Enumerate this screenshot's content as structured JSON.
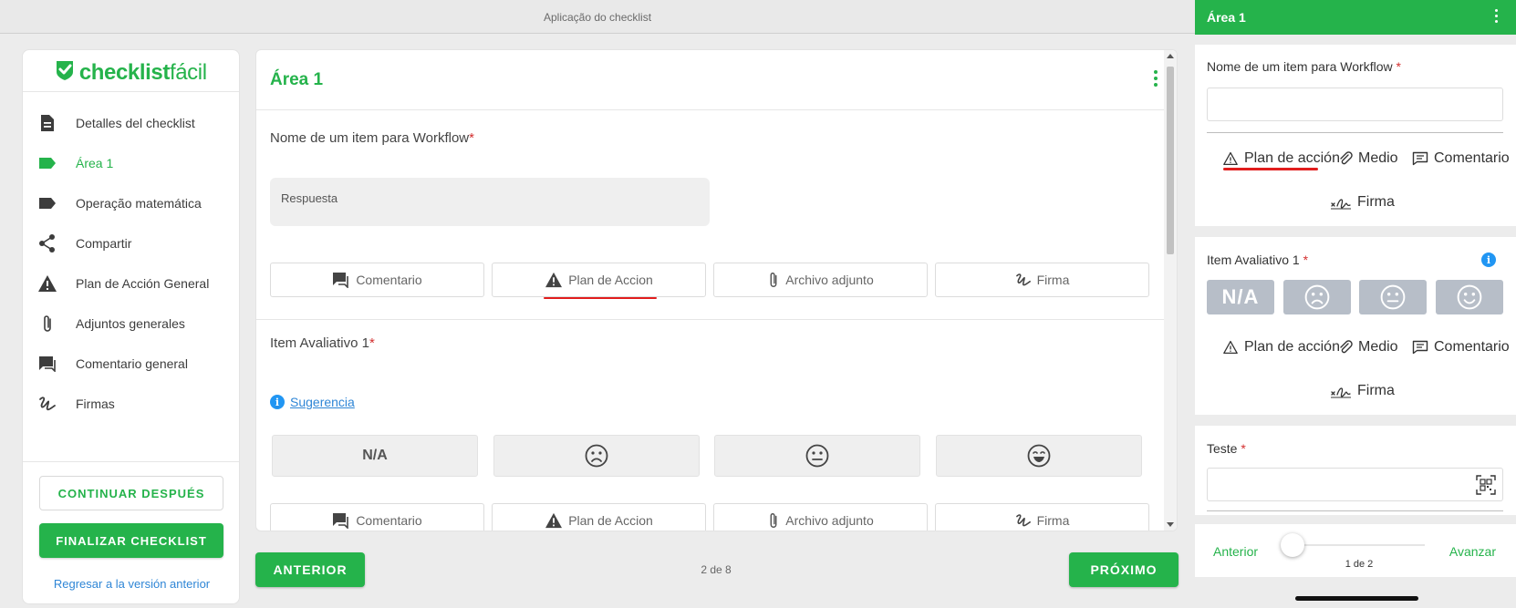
{
  "window": {
    "title": "Aplicação do checklist"
  },
  "logo": {
    "text_bold": "checklist",
    "text_light": "fácil",
    "icon": "check-shield-icon"
  },
  "sidebar": {
    "items": [
      {
        "label": "Detalles del checklist",
        "icon": "document-icon"
      },
      {
        "label": "Área 1",
        "icon": "tag-icon",
        "active": true
      },
      {
        "label": "Operação matemática",
        "icon": "tag-icon"
      },
      {
        "label": "Compartir",
        "icon": "share-icon"
      },
      {
        "label": "Plan de Acción General",
        "icon": "warning-icon"
      },
      {
        "label": "Adjuntos generales",
        "icon": "paperclip-icon"
      },
      {
        "label": "Comentario general",
        "icon": "comment-icon"
      },
      {
        "label": "Firmas",
        "icon": "signature-icon"
      }
    ],
    "continue_later": "CONTINUAR DESPUÉS",
    "finish": "FINALIZAR CHECKLIST",
    "back_link": "Regresar a la versión anterior"
  },
  "main": {
    "title": "Área 1",
    "q1": {
      "label": "Nome de um item para Workflow",
      "required": "*",
      "placeholder": "Respuesta"
    },
    "actions": {
      "comment": "Comentario",
      "action_plan": "Plan de Accion",
      "attachment": "Archivo adjunto",
      "signature": "Firma"
    },
    "q2": {
      "label": "Item Avaliativo 1",
      "required": "*",
      "hint": "Sugerencia",
      "options": [
        "N/A",
        "☹",
        "😐",
        "😄"
      ]
    }
  },
  "pager": {
    "prev": "ANTERIOR",
    "next": "PRÓXIMO",
    "indicator": "2 de 8"
  },
  "mobile": {
    "header": "Área 1",
    "q1_label": "Nome de um item para Workflow",
    "q2_label": "Item Avaliativo 1",
    "q3_label": "Teste",
    "required": "*",
    "actions": {
      "action_plan": "Plan de acción",
      "media": "Medio",
      "comment": "Comentario",
      "signature": "Firma"
    },
    "rating_na": "N/A",
    "footer": {
      "prev": "Anterior",
      "next": "Avanzar",
      "indicator": "1 de 2",
      "progress": 0
    }
  },
  "colors": {
    "brand": "#25b34b",
    "danger": "#e11d1d",
    "link": "#2f86d6",
    "rating_mobile": "#b7bec8"
  }
}
